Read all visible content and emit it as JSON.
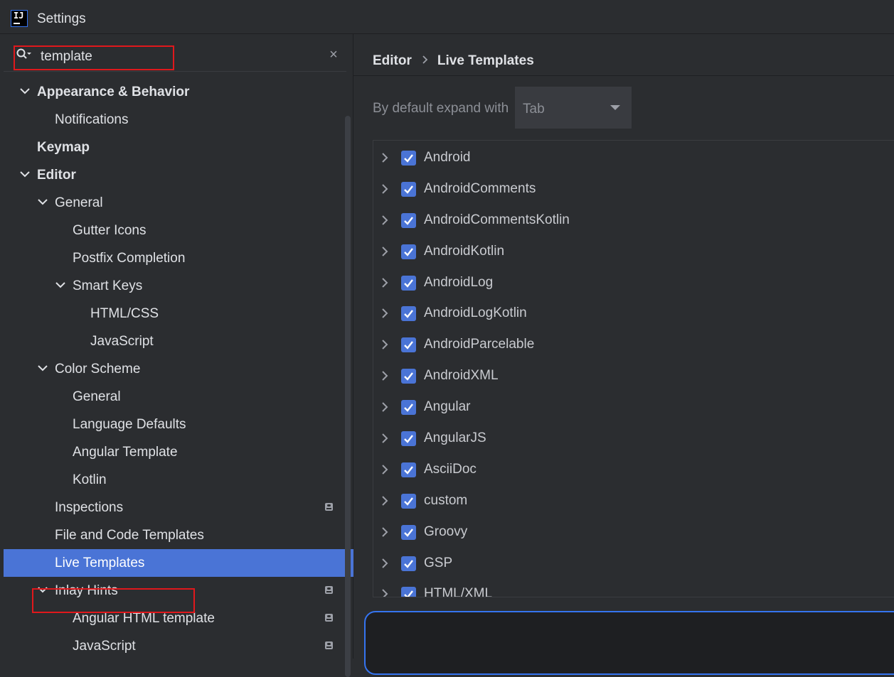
{
  "window": {
    "title": "Settings",
    "logo_text": "IJ"
  },
  "search": {
    "value": "template",
    "placeholder": ""
  },
  "tree": [
    {
      "label": "Appearance & Behavior",
      "level": 0,
      "expanded": true,
      "bold": true
    },
    {
      "label": "Notifications",
      "level": 1
    },
    {
      "label": "Keymap",
      "level": 0,
      "bold": true
    },
    {
      "label": "Editor",
      "level": 0,
      "expanded": true,
      "bold": true
    },
    {
      "label": "General",
      "level": 1,
      "expanded": true
    },
    {
      "label": "Gutter Icons",
      "level": 2
    },
    {
      "label": "Postfix Completion",
      "level": 2
    },
    {
      "label": "Smart Keys",
      "level": 2,
      "expanded": true
    },
    {
      "label": "HTML/CSS",
      "level": 3
    },
    {
      "label": "JavaScript",
      "level": 3
    },
    {
      "label": "Color Scheme",
      "level": 1,
      "expanded": true
    },
    {
      "label": "General",
      "level": 2
    },
    {
      "label": "Language Defaults",
      "level": 2
    },
    {
      "label": "Angular Template",
      "level": 2
    },
    {
      "label": "Kotlin",
      "level": 2
    },
    {
      "label": "Inspections",
      "level": 1,
      "badge": true
    },
    {
      "label": "File and Code Templates",
      "level": 1
    },
    {
      "label": "Live Templates",
      "level": 1,
      "selected": true
    },
    {
      "label": "Inlay Hints",
      "level": 1,
      "expanded": true,
      "badge": true
    },
    {
      "label": "Angular HTML template",
      "level": 2,
      "badge": true
    },
    {
      "label": "JavaScript",
      "level": 2,
      "badge": true
    }
  ],
  "breadcrumb": {
    "parent": "Editor",
    "current": "Live Templates"
  },
  "expand_with": {
    "label": "By default expand with",
    "value": "Tab"
  },
  "template_groups": [
    {
      "name": "Android",
      "checked": true
    },
    {
      "name": "AndroidComments",
      "checked": true
    },
    {
      "name": "AndroidCommentsKotlin",
      "checked": true
    },
    {
      "name": "AndroidKotlin",
      "checked": true
    },
    {
      "name": "AndroidLog",
      "checked": true
    },
    {
      "name": "AndroidLogKotlin",
      "checked": true
    },
    {
      "name": "AndroidParcelable",
      "checked": true
    },
    {
      "name": "AndroidXML",
      "checked": true
    },
    {
      "name": "Angular",
      "checked": true
    },
    {
      "name": "AngularJS",
      "checked": true
    },
    {
      "name": "AsciiDoc",
      "checked": true
    },
    {
      "name": "custom",
      "checked": true
    },
    {
      "name": "Groovy",
      "checked": true
    },
    {
      "name": "GSP",
      "checked": true
    },
    {
      "name": "HTML/XML",
      "checked": true
    }
  ],
  "colors": {
    "background": "#2b2d30",
    "selection": "#4a74d6",
    "checkbox": "#4a74d6",
    "highlight_box": "#e0181c",
    "focus_border": "#3574f0"
  },
  "icons": {
    "search": "search-icon",
    "clear": "close-icon",
    "expand": "chevron-down-icon",
    "collapsed": "chevron-right-icon",
    "badge": "project-level-icon"
  }
}
